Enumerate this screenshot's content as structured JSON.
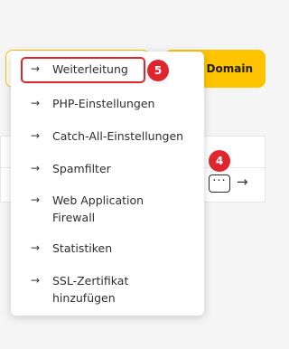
{
  "background": {
    "primary_button_label": "e Domain"
  },
  "row": {
    "more_button_label": "···",
    "arrow_glyph": "→"
  },
  "menu": {
    "items": [
      {
        "label": "Weiterleitung"
      },
      {
        "label": "PHP-Einstellungen"
      },
      {
        "label": "Catch-All-Einstellungen"
      },
      {
        "label": "Spamfilter"
      },
      {
        "label": "Web Application\nFirewall"
      },
      {
        "label": "Statistiken"
      },
      {
        "label": "SSL-Zertifikat\nhinzufügen"
      }
    ],
    "arrow_glyph": "→"
  },
  "markers": {
    "step_5": "5",
    "step_4": "4"
  },
  "colors": {
    "accent_yellow": "#ffc400",
    "marker_red": "#e0262d"
  }
}
